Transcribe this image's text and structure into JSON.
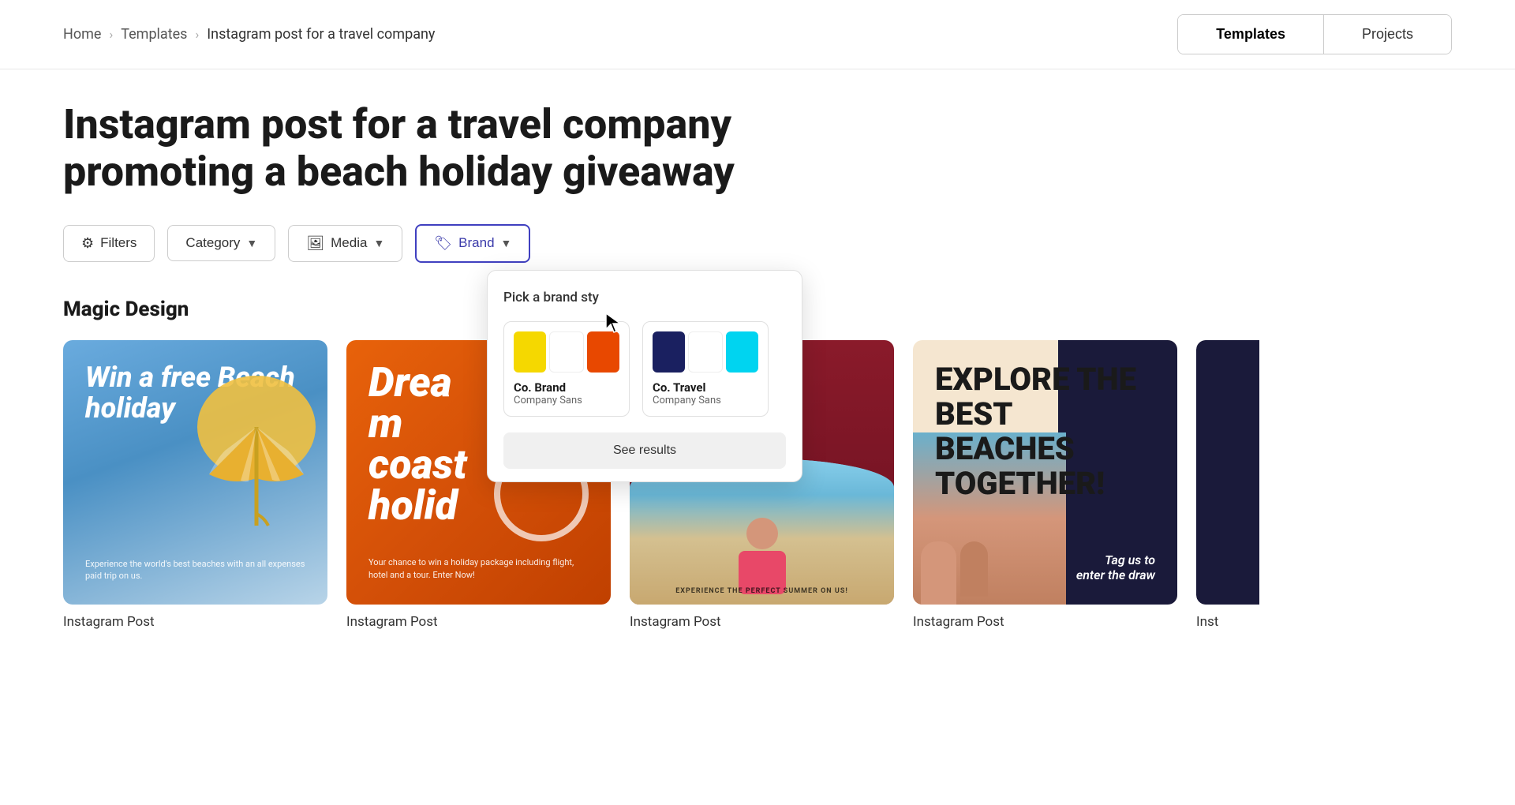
{
  "nav": {
    "breadcrumb": {
      "home": "Home",
      "templates": "Templates",
      "current": "Instagram post for a travel company"
    },
    "buttons": {
      "templates": "Templates",
      "projects": "Projects"
    }
  },
  "page": {
    "title": "Instagram post for a travel company promoting a beach holiday giveaway"
  },
  "filters": {
    "filters_label": "Filters",
    "category_label": "Category",
    "media_label": "Media",
    "brand_label": "Brand"
  },
  "brand_dropdown": {
    "title": "Pick a brand sty",
    "brands": [
      {
        "name": "Co. Brand",
        "font": "Company Sans",
        "colors": [
          "#f5d800",
          "#ffffff",
          "#e84800"
        ]
      },
      {
        "name": "Co. Travel",
        "font": "Company Sans",
        "colors": [
          "#1a2060",
          "#ffffff",
          "#00d4f0"
        ]
      }
    ],
    "see_results": "See results"
  },
  "section": {
    "title": "Magic Design"
  },
  "cards": [
    {
      "label": "Instagram Post"
    },
    {
      "label": "Instagram Post"
    },
    {
      "label": "Instagram Post"
    },
    {
      "label": "Instagram Post"
    },
    {
      "label": "Inst"
    }
  ]
}
